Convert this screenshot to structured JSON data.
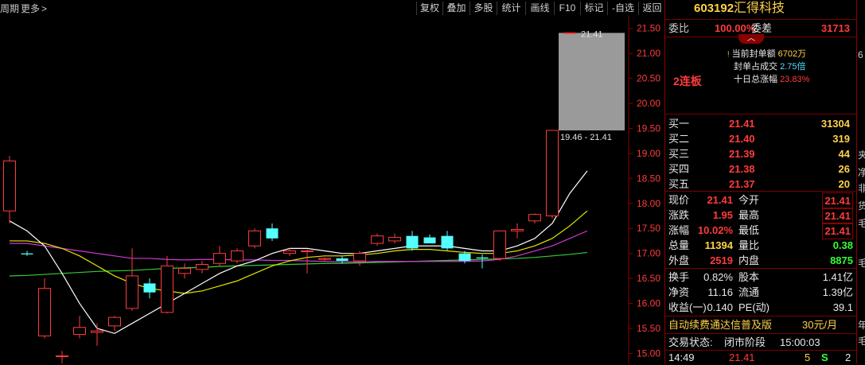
{
  "toolbar": {
    "period_label": "周期",
    "more_label": "更多",
    "more_arrow": ">",
    "buttons": [
      "复权",
      "叠加",
      "多股",
      "统计",
      "画线",
      "F10",
      "标记",
      "-自选",
      "返回"
    ]
  },
  "chart": {
    "price_ticks": [
      "21.50",
      "21.00",
      "20.50",
      "20.00",
      "19.50",
      "19.00",
      "18.50",
      "18.00",
      "17.50",
      "17.00",
      "16.50",
      "16.00",
      "15.50",
      "15.00"
    ],
    "gap_top_label": "21.41",
    "gap_range_label": "19.46 - 21.41"
  },
  "chart_data": {
    "type": "candlestick",
    "y_range": [
      14.8,
      21.75
    ],
    "candles": [
      {
        "o": 17.85,
        "h": 18.95,
        "l": 17.6,
        "c": 18.85
      },
      {
        "o": 17.0,
        "h": 17.05,
        "l": 16.95,
        "c": 16.98
      },
      {
        "o": 15.35,
        "h": 16.5,
        "l": 15.3,
        "c": 16.3
      },
      {
        "o": 14.95,
        "h": 15.05,
        "l": 14.75,
        "c": 14.95
      },
      {
        "o": 15.38,
        "h": 15.75,
        "l": 15.3,
        "c": 15.52
      },
      {
        "o": 15.42,
        "h": 15.6,
        "l": 15.15,
        "c": 15.45
      },
      {
        "o": 15.55,
        "h": 15.75,
        "l": 15.45,
        "c": 15.72
      },
      {
        "o": 15.9,
        "h": 17.1,
        "l": 15.85,
        "c": 16.55
      },
      {
        "o": 16.4,
        "h": 16.5,
        "l": 16.1,
        "c": 16.22
      },
      {
        "o": 15.82,
        "h": 16.95,
        "l": 15.8,
        "c": 16.75
      },
      {
        "o": 16.6,
        "h": 16.8,
        "l": 16.5,
        "c": 16.7
      },
      {
        "o": 16.68,
        "h": 16.85,
        "l": 16.6,
        "c": 16.78
      },
      {
        "o": 16.8,
        "h": 17.15,
        "l": 16.75,
        "c": 17.0
      },
      {
        "o": 16.85,
        "h": 17.1,
        "l": 16.8,
        "c": 17.05
      },
      {
        "o": 17.15,
        "h": 17.5,
        "l": 17.1,
        "c": 17.45
      },
      {
        "o": 17.5,
        "h": 17.6,
        "l": 17.25,
        "c": 17.3
      },
      {
        "o": 17.0,
        "h": 17.1,
        "l": 16.95,
        "c": 17.05
      },
      {
        "o": 17.05,
        "h": 17.08,
        "l": 16.6,
        "c": 17.05
      },
      {
        "o": 16.88,
        "h": 16.92,
        "l": 16.85,
        "c": 16.9
      },
      {
        "o": 16.9,
        "h": 16.95,
        "l": 16.8,
        "c": 16.85
      },
      {
        "o": 16.85,
        "h": 17.05,
        "l": 16.75,
        "c": 17.0
      },
      {
        "o": 17.2,
        "h": 17.4,
        "l": 17.15,
        "c": 17.35
      },
      {
        "o": 17.25,
        "h": 17.4,
        "l": 17.2,
        "c": 17.32
      },
      {
        "o": 17.35,
        "h": 17.45,
        "l": 17.05,
        "c": 17.1
      },
      {
        "o": 17.32,
        "h": 17.38,
        "l": 17.25,
        "c": 17.2
      },
      {
        "o": 17.35,
        "h": 17.45,
        "l": 17.05,
        "c": 17.1
      },
      {
        "o": 17.0,
        "h": 17.05,
        "l": 16.8,
        "c": 16.85
      },
      {
        "o": 16.92,
        "h": 16.98,
        "l": 16.7,
        "c": 16.9
      },
      {
        "o": 16.9,
        "h": 17.45,
        "l": 16.85,
        "c": 17.45
      },
      {
        "o": 17.45,
        "h": 17.6,
        "l": 17.3,
        "c": 17.48
      },
      {
        "o": 17.65,
        "h": 17.8,
        "l": 17.6,
        "c": 17.78
      },
      {
        "o": 17.75,
        "h": 19.46,
        "l": 17.7,
        "c": 19.46
      },
      {
        "o": 21.41,
        "h": 21.41,
        "l": 21.41,
        "c": 21.41
      }
    ],
    "ma_white": [
      17.65,
      17.45,
      17.15,
      16.6,
      16.0,
      15.5,
      15.4,
      15.6,
      15.8,
      16.0,
      16.2,
      16.4,
      16.6,
      16.75,
      16.85,
      17.0,
      17.1,
      17.1,
      17.05,
      17.0,
      17.0,
      17.05,
      17.1,
      17.15,
      17.15,
      17.15,
      17.1,
      17.05,
      17.05,
      17.15,
      17.3,
      17.6,
      18.2,
      18.65
    ],
    "ma_yellow": [
      17.25,
      17.25,
      17.2,
      17.1,
      16.95,
      16.75,
      16.55,
      16.4,
      16.3,
      16.25,
      16.2,
      16.25,
      16.35,
      16.45,
      16.6,
      16.75,
      16.85,
      16.92,
      16.95,
      16.95,
      16.97,
      17.0,
      17.05,
      17.08,
      17.08,
      17.05,
      17.02,
      17.0,
      17.0,
      17.05,
      17.15,
      17.3,
      17.55,
      17.85
    ],
    "ma_magenta": [
      17.2,
      17.2,
      17.15,
      17.1,
      17.05,
      17.0,
      16.95,
      16.9,
      16.9,
      16.88,
      16.87,
      16.88,
      16.88,
      16.87,
      16.87,
      16.86,
      16.86,
      16.85,
      16.84,
      16.83,
      16.83,
      16.84,
      16.84,
      16.84,
      16.84,
      16.84,
      16.84,
      16.85,
      16.88,
      16.95,
      17.05,
      17.15,
      17.3,
      17.45
    ],
    "ma_green": [
      16.55,
      16.56,
      16.58,
      16.6,
      16.62,
      16.64,
      16.65,
      16.66,
      16.68,
      16.7,
      16.71,
      16.72,
      16.74,
      16.75,
      16.76,
      16.77,
      16.78,
      16.79,
      16.8,
      16.8,
      16.81,
      16.82,
      16.83,
      16.84,
      16.85,
      16.86,
      16.87,
      16.88,
      16.89,
      16.9,
      16.92,
      16.95,
      16.98,
      17.02
    ]
  },
  "panel": {
    "code": "603192",
    "name": "汇得科技",
    "weibi_label": "委比",
    "weibi_value": "100.00%",
    "weicha_label": "委差",
    "weicha_value": "31713",
    "streak_label": "2连板",
    "seal_amount_label": "当前封单额",
    "seal_amount_value": "6702万",
    "seal_ratio_label": "封单占成交",
    "seal_ratio_value": "2.75倍",
    "ten_day_label": "十日总涨幅",
    "ten_day_value": "23.83%",
    "bids": [
      {
        "label": "买一",
        "price": "21.41",
        "vol": "31304"
      },
      {
        "label": "买二",
        "price": "21.40",
        "vol": "319"
      },
      {
        "label": "买三",
        "price": "21.39",
        "vol": "44"
      },
      {
        "label": "买四",
        "price": "21.38",
        "vol": "26"
      },
      {
        "label": "买五",
        "price": "21.37",
        "vol": "20"
      }
    ],
    "stats": [
      {
        "l1": "现价",
        "v1": "21.41",
        "l2": "今开",
        "v2": "21.41"
      },
      {
        "l1": "涨跌",
        "v1": "1.95",
        "l2": "最高",
        "v2": "21.41"
      },
      {
        "l1": "涨幅",
        "v1": "10.02%",
        "l2": "最低",
        "v2": "21.41"
      },
      {
        "l1": "总量",
        "v1": "11394",
        "l2": "量比",
        "v2": "0.38"
      },
      {
        "l1": "外盘",
        "v1": "2519",
        "l2": "内盘",
        "v2": "8875"
      }
    ],
    "fin": [
      {
        "l1": "换手",
        "v1": "0.82%",
        "l2": "股本",
        "v2": "1.41亿"
      },
      {
        "l1": "净资",
        "v1": "11.16",
        "l2": "流通",
        "v2": "1.39亿"
      },
      {
        "l1": "收益(一)",
        "v1": "0.140",
        "l2": "PE(动)",
        "v2": "39.1"
      }
    ],
    "ad_text": "自动续费通达信普及版",
    "ad_price": "30元/月",
    "status_label": "交易状态:",
    "status_value": "闭市阶段",
    "status_time": "15:00:03",
    "tick_time": "14:49",
    "tick_price": "21.41",
    "tick_vol": "5",
    "tick_side": "S",
    "tick_count": "2"
  },
  "far_chars": [
    "6",
    "夹",
    "净",
    "非",
    "货",
    "毛",
    "毛",
    "年",
    "毛"
  ]
}
